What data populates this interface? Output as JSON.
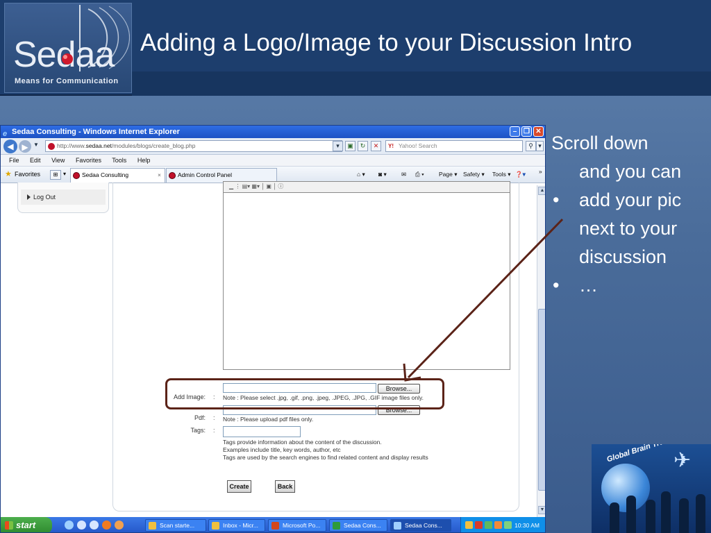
{
  "slide": {
    "title": "Adding a Logo/Image to your Discussion Intro",
    "logo_word": "Sedaa",
    "logo_tagline": "Means for Communication",
    "bullets": {
      "intro": [
        "Scroll down",
        "and you can"
      ],
      "items": [
        [
          "add your pic",
          "next to your",
          "discussion"
        ],
        [
          "…"
        ]
      ],
      "bullet_char": "•"
    },
    "badge_text": "Global Brain Trust"
  },
  "browser": {
    "window_title": "Sedaa Consulting - Windows Internet Explorer",
    "url_prefix": "http://www.",
    "url_domain": "sedaa.net",
    "url_path": "/modules/blogs/create_blog.php",
    "search_placeholder": "Yahoo! Search",
    "search_logo": "Y!",
    "menu": [
      "File",
      "Edit",
      "View",
      "Favorites",
      "Tools",
      "Help"
    ],
    "favorites_label": "Favorites",
    "tabs": [
      {
        "label": "Sedaa Consulting",
        "close": "×"
      },
      {
        "label": "Admin Control Panel"
      }
    ],
    "commands": [
      "Page ▾",
      "Safety ▾",
      "Tools ▾"
    ],
    "overflow": "»"
  },
  "page": {
    "sidebar_item": "Log Out",
    "form": {
      "add_image_label": "Add Image:",
      "pdf_label": "Pdf:",
      "tags_label": "Tags:",
      "colon": ":",
      "browse_label": "Browse...",
      "image_note": "Note : Please select .jpg, .gif, .png, .jpeg, .JPEG, .JPG, .GIF image files only.",
      "pdf_note": "Note : Please upload pdf files only.",
      "tags_help": [
        "Tags provide information about the content of the discussion.",
        "Examples include title, key words, author, etc",
        "Tags are used by the search engines to find related content and display results"
      ],
      "create_label": "Create",
      "back_label": "Back"
    }
  },
  "taskbar": {
    "start_label": "start",
    "tasks": [
      {
        "label": "Scan starte..."
      },
      {
        "label": "Inbox - Micr..."
      },
      {
        "label": "Microsoft Po..."
      },
      {
        "label": "Sedaa Cons..."
      },
      {
        "label": "Sedaa Cons..."
      }
    ],
    "clock": "10:30 AM"
  },
  "colors": {
    "slide_bg": "#4a6c9a",
    "header_bg": "#1d3e6d",
    "highlight_border": "#5b2318",
    "arrow": "#5b2318"
  }
}
